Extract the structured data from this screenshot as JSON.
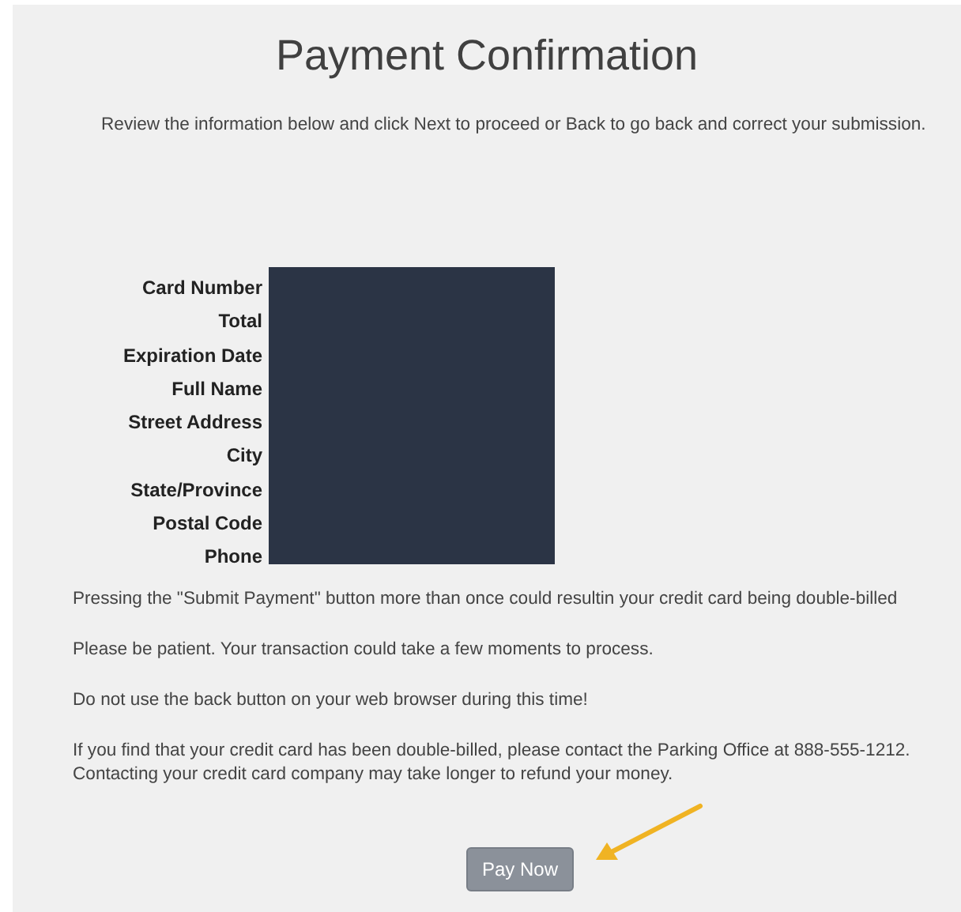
{
  "title": "Payment Confirmation",
  "instructions": "Review the information below and click Next to proceed or Back to go back and correct your submission.",
  "fields": [
    {
      "label": "Card Number"
    },
    {
      "label": "Total"
    },
    {
      "label": "Expiration Date"
    },
    {
      "label": "Full Name"
    },
    {
      "label": "Street Address"
    },
    {
      "label": "City"
    },
    {
      "label": "State/Province"
    },
    {
      "label": "Postal Code"
    },
    {
      "label": "Phone"
    }
  ],
  "notices": [
    [
      "Pressing the \"Submit Payment\" button more than once could resultin your credit card being double-billed"
    ],
    [
      "Please be patient. Your transaction could take a few moments to process."
    ],
    [
      "Do not use the back button on your web browser during this time!"
    ],
    [
      "If you find that your credit card has been double-billed, please contact the Parking Office at 888-555-1212.",
      "Contacting your credit card company may take longer to refund your money."
    ]
  ],
  "button": {
    "label": "Pay Now"
  }
}
